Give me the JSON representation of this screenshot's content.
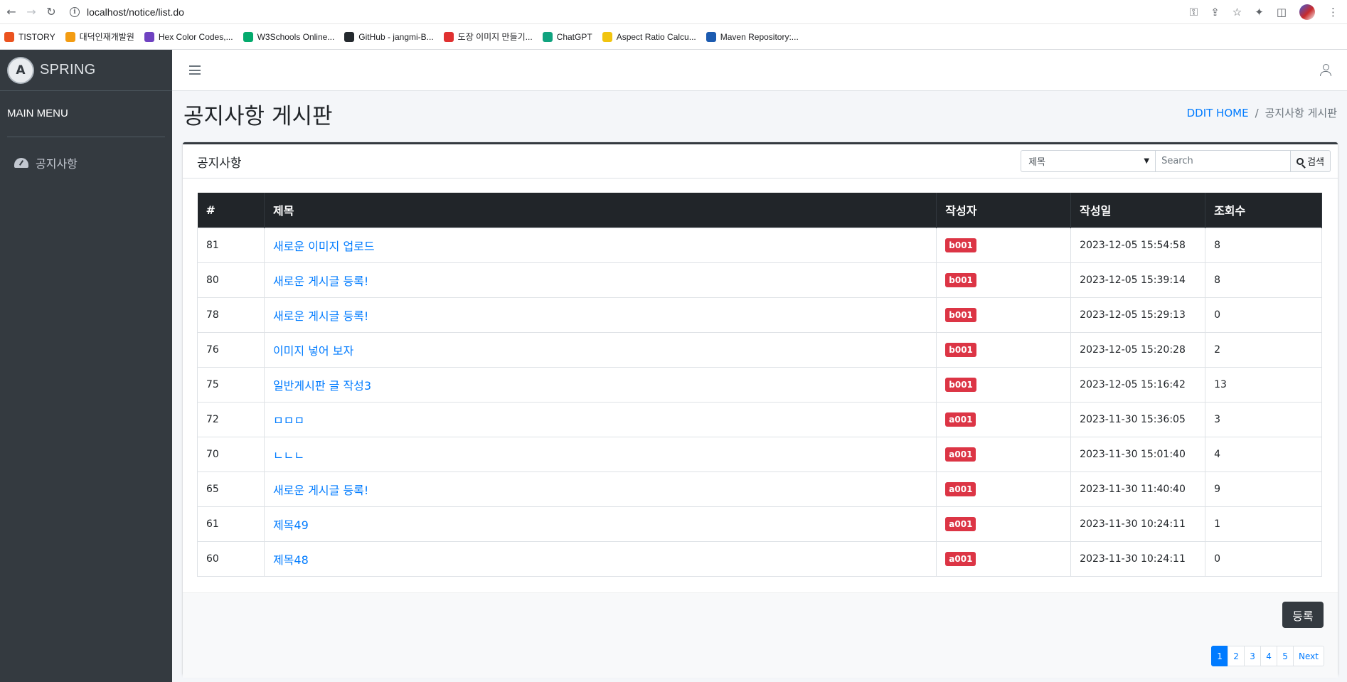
{
  "browser": {
    "url": "localhost/notice/list.do",
    "bookmarks": [
      {
        "label": "TISTORY",
        "color": "#eb531f"
      },
      {
        "label": "대덕인재개발원",
        "color": "#f39c12"
      },
      {
        "label": "Hex Color Codes,...",
        "color": "#6f42c1"
      },
      {
        "label": "W3Schools Online...",
        "color": "#04aa6d"
      },
      {
        "label": "GitHub - jangmi-B...",
        "color": "#24292e"
      },
      {
        "label": "도장 이미지 만들기...",
        "color": "#e03131"
      },
      {
        "label": "ChatGPT",
        "color": "#10a37f"
      },
      {
        "label": "Aspect Ratio Calcu...",
        "color": "#f1c40f"
      },
      {
        "label": "Maven Repository:...",
        "color": "#1c5bb0"
      }
    ]
  },
  "sidebar": {
    "brand": "SPRING",
    "brand_logo": "A",
    "menu_header": "MAIN MENU",
    "items": [
      {
        "label": "공지사항",
        "icon": "dashboard-icon"
      }
    ]
  },
  "header": {
    "title": "공지사항 게시판",
    "breadcrumb_home": "DDIT HOME",
    "breadcrumb_current": "공지사항 게시판"
  },
  "card": {
    "title": "공지사항",
    "search_select": "제목",
    "search_placeholder": "Search",
    "search_button": "검색",
    "columns": [
      "#",
      "제목",
      "작성자",
      "작성일",
      "조회수"
    ],
    "rows": [
      {
        "no": "81",
        "title": "새로운 이미지 업로드",
        "writer": "b001",
        "date": "2023-12-05 15:54:58",
        "views": "8"
      },
      {
        "no": "80",
        "title": "새로운 게시글 등록!",
        "writer": "b001",
        "date": "2023-12-05 15:39:14",
        "views": "8"
      },
      {
        "no": "78",
        "title": "새로운 게시글 등록!",
        "writer": "b001",
        "date": "2023-12-05 15:29:13",
        "views": "0"
      },
      {
        "no": "76",
        "title": "이미지 넣어 보자",
        "writer": "b001",
        "date": "2023-12-05 15:20:28",
        "views": "2"
      },
      {
        "no": "75",
        "title": "일반게시판 글 작성3",
        "writer": "b001",
        "date": "2023-12-05 15:16:42",
        "views": "13"
      },
      {
        "no": "72",
        "title": "ㅁㅁㅁ",
        "writer": "a001",
        "date": "2023-11-30 15:36:05",
        "views": "3"
      },
      {
        "no": "70",
        "title": "ㄴㄴㄴ",
        "writer": "a001",
        "date": "2023-11-30 15:01:40",
        "views": "4"
      },
      {
        "no": "65",
        "title": "새로운 게시글 등록!",
        "writer": "a001",
        "date": "2023-11-30 11:40:40",
        "views": "9"
      },
      {
        "no": "61",
        "title": "제목49",
        "writer": "a001",
        "date": "2023-11-30 10:24:11",
        "views": "1"
      },
      {
        "no": "60",
        "title": "제목48",
        "writer": "a001",
        "date": "2023-11-30 10:24:11",
        "views": "0"
      }
    ],
    "register_button": "등록",
    "pages": [
      "1",
      "2",
      "3",
      "4",
      "5"
    ],
    "next_label": "Next"
  },
  "colors": {
    "accent": "#007bff",
    "badge": "#dc3545",
    "sidebar": "#343a40"
  }
}
